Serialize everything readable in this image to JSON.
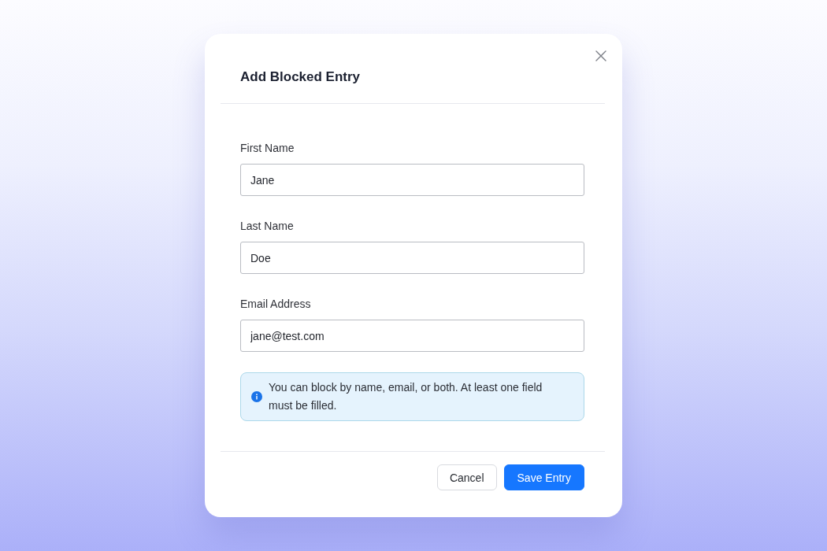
{
  "dialog": {
    "title": "Add Blocked Entry",
    "fields": [
      {
        "label": "First Name",
        "value": "Jane"
      },
      {
        "label": "Last Name",
        "value": "Doe"
      },
      {
        "label": "Email Address",
        "value": "jane@test.com"
      }
    ],
    "info": {
      "text": "You can block by name, email, or both. At least one field must be filled."
    },
    "buttons": [
      {
        "label": "Cancel",
        "kind": "secondary"
      },
      {
        "label": "Save Entry",
        "kind": "primary"
      }
    ]
  }
}
